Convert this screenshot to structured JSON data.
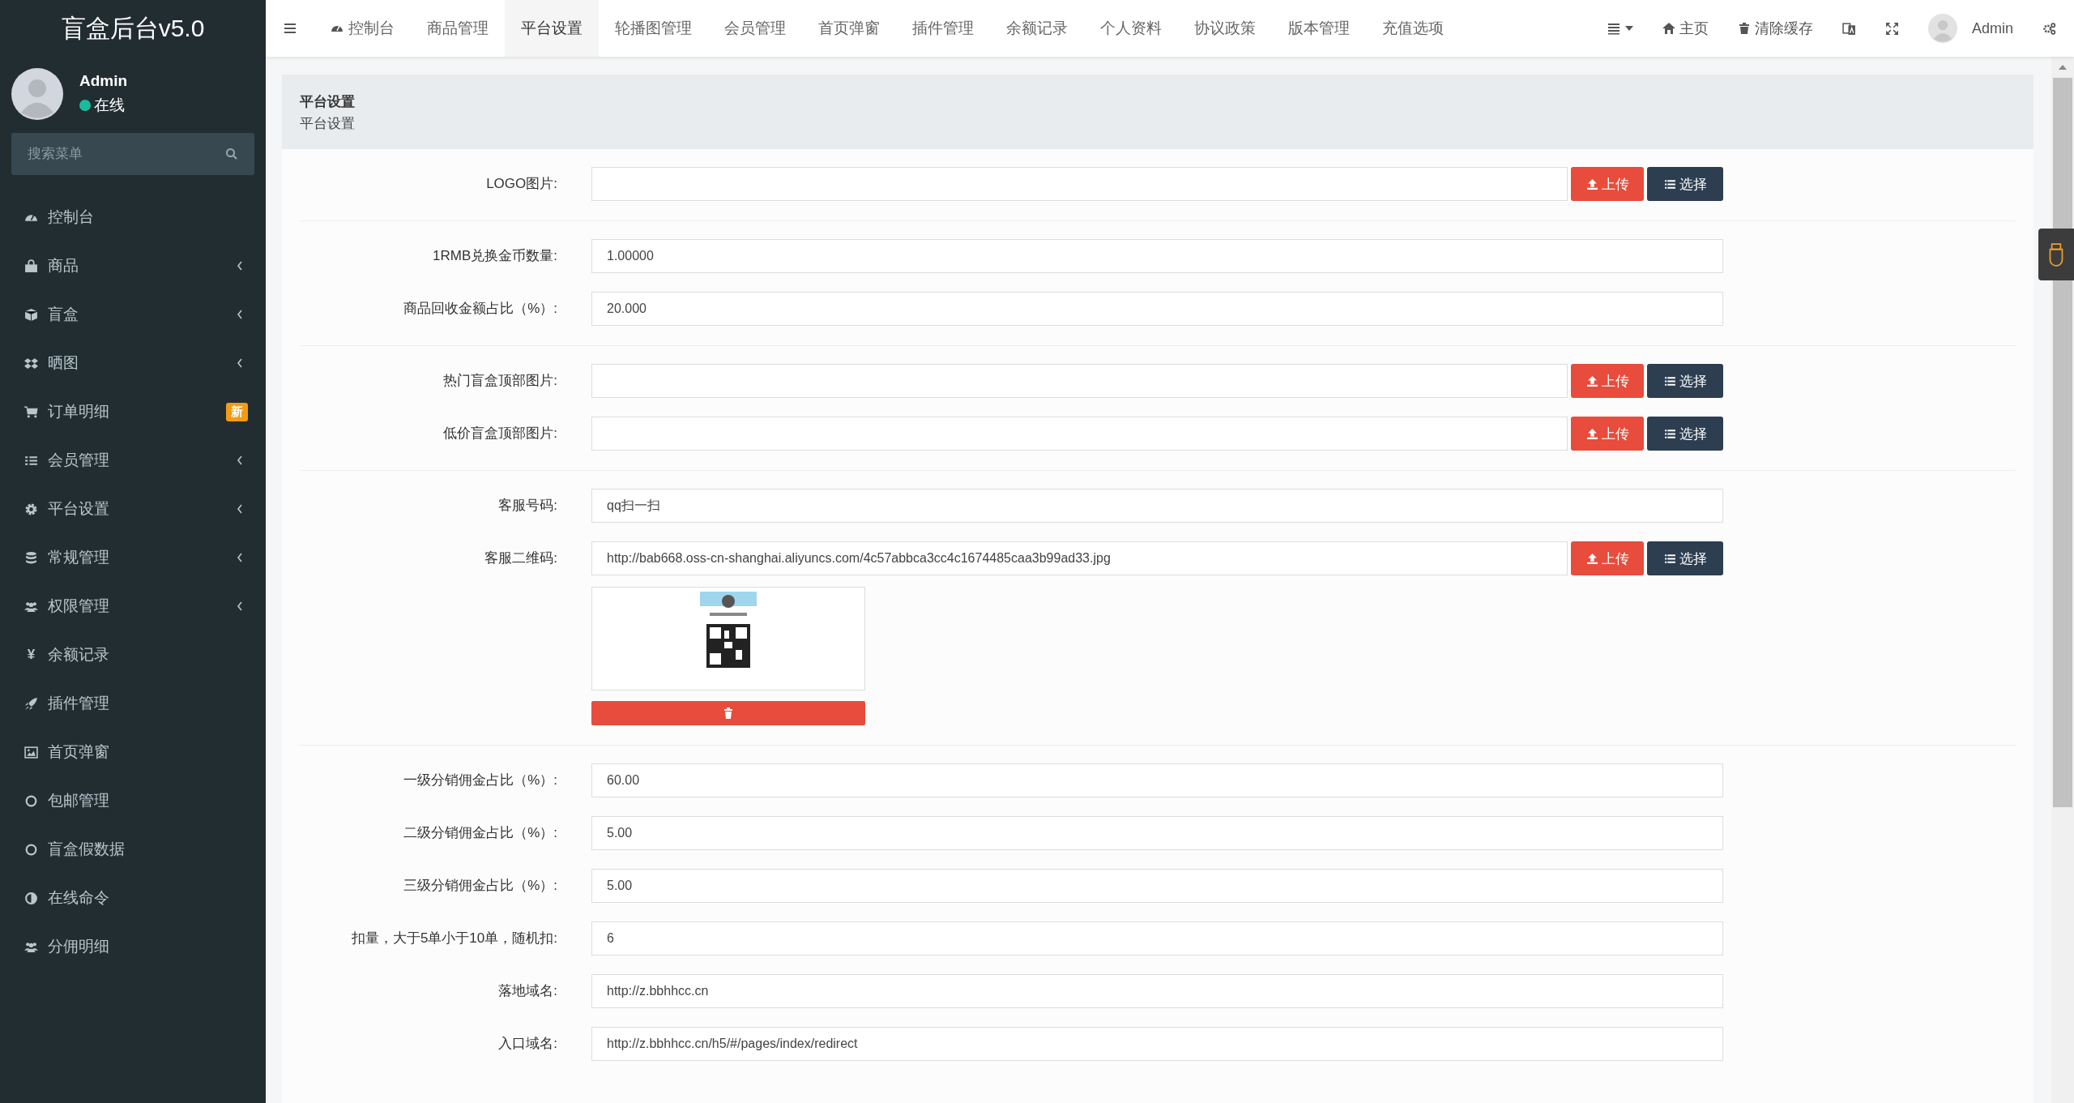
{
  "sidebar": {
    "title": "盲盒后台v5.0",
    "user": {
      "name": "Admin",
      "status": "在线",
      "online": true
    },
    "search": {
      "placeholder": "搜索菜单"
    },
    "items": [
      {
        "label": "控制台",
        "has_submenu": false
      },
      {
        "label": "商品",
        "has_submenu": true
      },
      {
        "label": "盲盒",
        "has_submenu": true
      },
      {
        "label": "晒图",
        "has_submenu": true
      },
      {
        "label": "订单明细",
        "has_submenu": false,
        "badge": "新"
      },
      {
        "label": "会员管理",
        "has_submenu": true
      },
      {
        "label": "平台设置",
        "has_submenu": true
      },
      {
        "label": "常规管理",
        "has_submenu": true
      },
      {
        "label": "权限管理",
        "has_submenu": true
      },
      {
        "label": "余额记录",
        "has_submenu": false,
        "glyph": "¥"
      },
      {
        "label": "插件管理",
        "has_submenu": false
      },
      {
        "label": "首页弹窗",
        "has_submenu": false
      },
      {
        "label": "包邮管理",
        "has_submenu": false
      },
      {
        "label": "盲盒假数据",
        "has_submenu": false
      },
      {
        "label": "在线命令",
        "has_submenu": false
      },
      {
        "label": "分佣明细",
        "has_submenu": false
      }
    ]
  },
  "topbar": {
    "tabs": [
      {
        "label": "控制台",
        "selected": false
      },
      {
        "label": "商品管理",
        "selected": false
      },
      {
        "label": "平台设置",
        "selected": true
      },
      {
        "label": "轮播图管理",
        "selected": false
      },
      {
        "label": "会员管理",
        "selected": false
      },
      {
        "label": "首页弹窗",
        "selected": false
      },
      {
        "label": "插件管理",
        "selected": false
      },
      {
        "label": "余额记录",
        "selected": false
      },
      {
        "label": "个人资料",
        "selected": false
      },
      {
        "label": "协议政策",
        "selected": false
      },
      {
        "label": "版本管理",
        "selected": false
      },
      {
        "label": "充值选项",
        "selected": false
      }
    ],
    "home": "主页",
    "clear_cache": "清除缓存",
    "user": "Admin"
  },
  "panel": {
    "title": "平台设置",
    "subtitle": "平台设置",
    "sections": [
      {
        "fields": [
          {
            "label": "LOGO图片:",
            "kind": "upload",
            "upload": "上传",
            "choose": "选择"
          }
        ]
      },
      {
        "fields": [
          {
            "label": "1RMB兑换金币数量:",
            "value": "1.00000",
            "kind": "text"
          },
          {
            "label": "商品回收金额占比（%）:",
            "value": "20.000",
            "kind": "text"
          }
        ]
      },
      {
        "fields": [
          {
            "label": "热门盲盒顶部图片:",
            "kind": "upload",
            "upload": "上传",
            "choose": "选择"
          },
          {
            "label": "低价盲盒顶部图片:",
            "kind": "upload",
            "upload": "上传",
            "choose": "选择"
          }
        ]
      },
      {
        "fields": [
          {
            "label": "客服号码:",
            "value": "qq扫一扫",
            "kind": "text"
          },
          {
            "label": "客服二维码:",
            "value": "http://bab668.oss-cn-shanghai.aliyuncs.com/4c57abbca3cc4c1674485caa3b99ad33.jpg",
            "kind": "upload",
            "upload": "上传",
            "choose": "选择"
          }
        ]
      },
      {
        "fields": [
          {
            "label": "一级分销佣金占比（%）:",
            "value": "60.00",
            "kind": "text"
          },
          {
            "label": "二级分销佣金占比（%）:",
            "value": "5.00",
            "kind": "text"
          },
          {
            "label": "三级分销佣金占比（%）:",
            "value": "5.00",
            "kind": "text"
          },
          {
            "label": "扣量，大于5单小于10单，随机扣:",
            "value": "6",
            "kind": "text"
          },
          {
            "label": "落地域名:",
            "value": "http://z.bbhhcc.cn",
            "kind": "text"
          },
          {
            "label": "入口域名:",
            "value": "http://z.bbhhcc.cn/h5/#/pages/index/redirect",
            "kind": "text"
          }
        ]
      }
    ]
  }
}
